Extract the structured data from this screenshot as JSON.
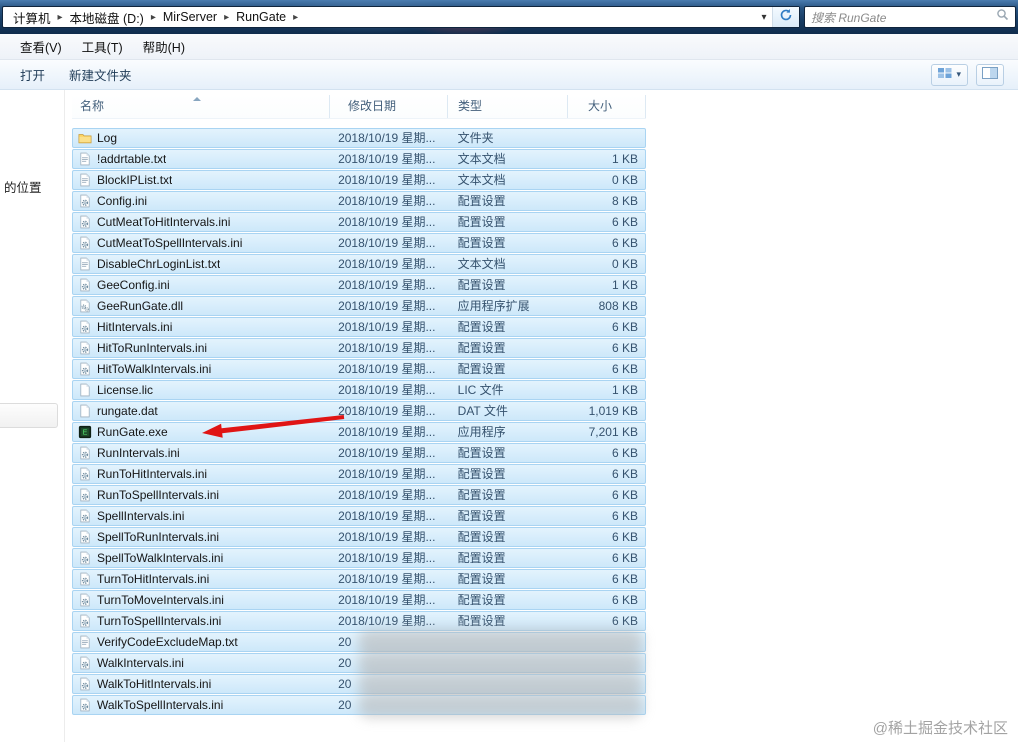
{
  "address_bar": {
    "breadcrumb": [
      "计算机",
      "本地磁盘 (D:)",
      "MirServer",
      "RunGate"
    ],
    "search_placeholder": "搜索 RunGate"
  },
  "menu_bar": {
    "items": [
      "查看(V)",
      "工具(T)",
      "帮助(H)"
    ]
  },
  "toolbar": {
    "items": [
      "打开",
      "新建文件夹"
    ]
  },
  "sidebar": {
    "visible_label": "的位置"
  },
  "file_list": {
    "columns": [
      "名称",
      "修改日期",
      "类型",
      "大小"
    ],
    "rows": [
      {
        "name": "Log",
        "icon": "folder",
        "date": "2018/10/19 星期...",
        "type": "文件夹",
        "size": ""
      },
      {
        "name": "!addrtable.txt",
        "icon": "text",
        "date": "2018/10/19 星期...",
        "type": "文本文档",
        "size": "1 KB"
      },
      {
        "name": "BlockIPList.txt",
        "icon": "text",
        "date": "2018/10/19 星期...",
        "type": "文本文档",
        "size": "0 KB"
      },
      {
        "name": "Config.ini",
        "icon": "ini",
        "date": "2018/10/19 星期...",
        "type": "配置设置",
        "size": "8 KB"
      },
      {
        "name": "CutMeatToHitIntervals.ini",
        "icon": "ini",
        "date": "2018/10/19 星期...",
        "type": "配置设置",
        "size": "6 KB"
      },
      {
        "name": "CutMeatToSpellIntervals.ini",
        "icon": "ini",
        "date": "2018/10/19 星期...",
        "type": "配置设置",
        "size": "6 KB"
      },
      {
        "name": "DisableChrLoginList.txt",
        "icon": "text",
        "date": "2018/10/19 星期...",
        "type": "文本文档",
        "size": "0 KB"
      },
      {
        "name": "GeeConfig.ini",
        "icon": "ini",
        "date": "2018/10/19 星期...",
        "type": "配置设置",
        "size": "1 KB"
      },
      {
        "name": "GeeRunGate.dll",
        "icon": "dll",
        "date": "2018/10/19 星期...",
        "type": "应用程序扩展",
        "size": "808 KB"
      },
      {
        "name": "HitIntervals.ini",
        "icon": "ini",
        "date": "2018/10/19 星期...",
        "type": "配置设置",
        "size": "6 KB"
      },
      {
        "name": "HitToRunIntervals.ini",
        "icon": "ini",
        "date": "2018/10/19 星期...",
        "type": "配置设置",
        "size": "6 KB"
      },
      {
        "name": "HitToWalkIntervals.ini",
        "icon": "ini",
        "date": "2018/10/19 星期...",
        "type": "配置设置",
        "size": "6 KB"
      },
      {
        "name": "License.lic",
        "icon": "file",
        "date": "2018/10/19 星期...",
        "type": "LIC 文件",
        "size": "1 KB"
      },
      {
        "name": "rungate.dat",
        "icon": "file",
        "date": "2018/10/19 星期...",
        "type": "DAT 文件",
        "size": "1,019 KB"
      },
      {
        "name": "RunGate.exe",
        "icon": "exe",
        "date": "2018/10/19 星期...",
        "type": "应用程序",
        "size": "7,201 KB"
      },
      {
        "name": "RunIntervals.ini",
        "icon": "ini",
        "date": "2018/10/19 星期...",
        "type": "配置设置",
        "size": "6 KB"
      },
      {
        "name": "RunToHitIntervals.ini",
        "icon": "ini",
        "date": "2018/10/19 星期...",
        "type": "配置设置",
        "size": "6 KB"
      },
      {
        "name": "RunToSpellIntervals.ini",
        "icon": "ini",
        "date": "2018/10/19 星期...",
        "type": "配置设置",
        "size": "6 KB"
      },
      {
        "name": "SpellIntervals.ini",
        "icon": "ini",
        "date": "2018/10/19 星期...",
        "type": "配置设置",
        "size": "6 KB"
      },
      {
        "name": "SpellToRunIntervals.ini",
        "icon": "ini",
        "date": "2018/10/19 星期...",
        "type": "配置设置",
        "size": "6 KB"
      },
      {
        "name": "SpellToWalkIntervals.ini",
        "icon": "ini",
        "date": "2018/10/19 星期...",
        "type": "配置设置",
        "size": "6 KB"
      },
      {
        "name": "TurnToHitIntervals.ini",
        "icon": "ini",
        "date": "2018/10/19 星期...",
        "type": "配置设置",
        "size": "6 KB"
      },
      {
        "name": "TurnToMoveIntervals.ini",
        "icon": "ini",
        "date": "2018/10/19 星期...",
        "type": "配置设置",
        "size": "6 KB"
      },
      {
        "name": "TurnToSpellIntervals.ini",
        "icon": "ini",
        "date": "2018/10/19 星期...",
        "type": "配置设置",
        "size": "6 KB"
      },
      {
        "name": "VerifyCodeExcludeMap.txt",
        "icon": "text",
        "date": "20",
        "type": "",
        "size": "",
        "blurred": true
      },
      {
        "name": "WalkIntervals.ini",
        "icon": "ini",
        "date": "20",
        "type": "",
        "size": "",
        "blurred": true
      },
      {
        "name": "WalkToHitIntervals.ini",
        "icon": "ini",
        "date": "20",
        "type": "",
        "size": "",
        "blurred": true
      },
      {
        "name": "WalkToSpellIntervals.ini",
        "icon": "ini",
        "date": "20",
        "type": "",
        "size": "",
        "blurred": true
      }
    ]
  },
  "annotations": {
    "red_arrow": {
      "points_to": "RunGate.exe",
      "color": "#e01515"
    }
  },
  "watermark": "@稀土掘金技术社区"
}
